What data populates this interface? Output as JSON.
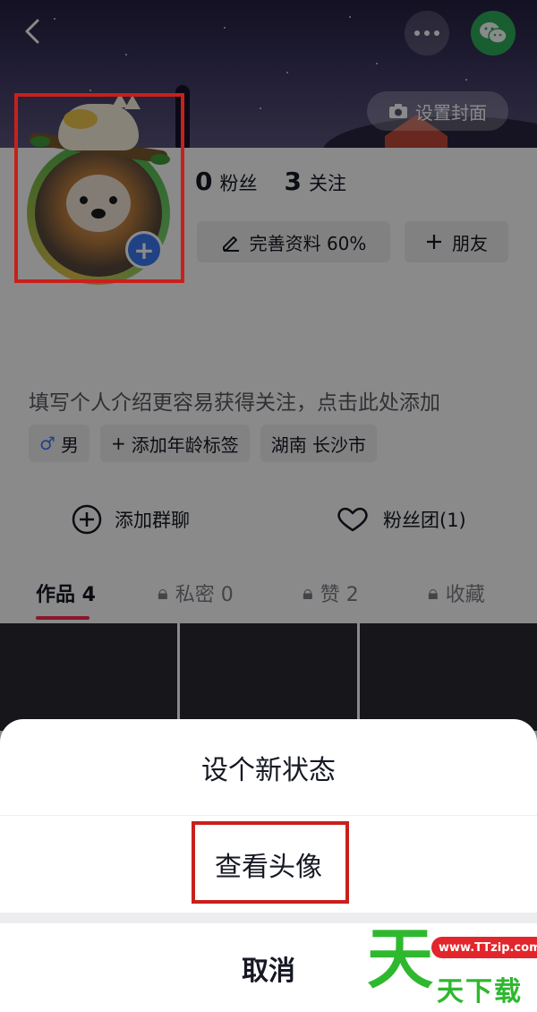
{
  "header": {
    "set_cover_label": "设置封面",
    "icons": {
      "back": "chevron-left-icon",
      "more": "more-dots-icon",
      "share": "wechat-icon",
      "camera": "camera-icon"
    }
  },
  "profile": {
    "fans_count": "0",
    "fans_label": "粉丝",
    "following_count": "3",
    "following_label": "关注",
    "complete_label": "完善资料 60%",
    "add_friend_label": "朋友",
    "bio_placeholder": "填写个人介绍更容易获得关注，点击此处添加",
    "tags": {
      "gender": "男",
      "age": "添加年龄标签",
      "location": "湖南 长沙市"
    }
  },
  "actions": {
    "add_group": "添加群聊",
    "fan_club": "粉丝团(1)"
  },
  "tabs": [
    {
      "label": "作品 4",
      "active": true,
      "locked": false
    },
    {
      "label": "私密 0",
      "active": false,
      "locked": true
    },
    {
      "label": "赞 2",
      "active": false,
      "locked": true
    },
    {
      "label": "收藏",
      "active": false,
      "locked": true
    }
  ],
  "sheet": {
    "set_status": "设个新状态",
    "view_avatar": "查看头像",
    "cancel": "取消"
  },
  "watermark": {
    "big_char": "天",
    "url": "www.TTzip.com",
    "text": "天下载"
  },
  "colors": {
    "accent": "#fe2c55",
    "highlight": "#c8201c",
    "badge_blue": "#3b7bf6",
    "wechat_green": "#2fae5a",
    "watermark_green": "#2eb82e"
  }
}
